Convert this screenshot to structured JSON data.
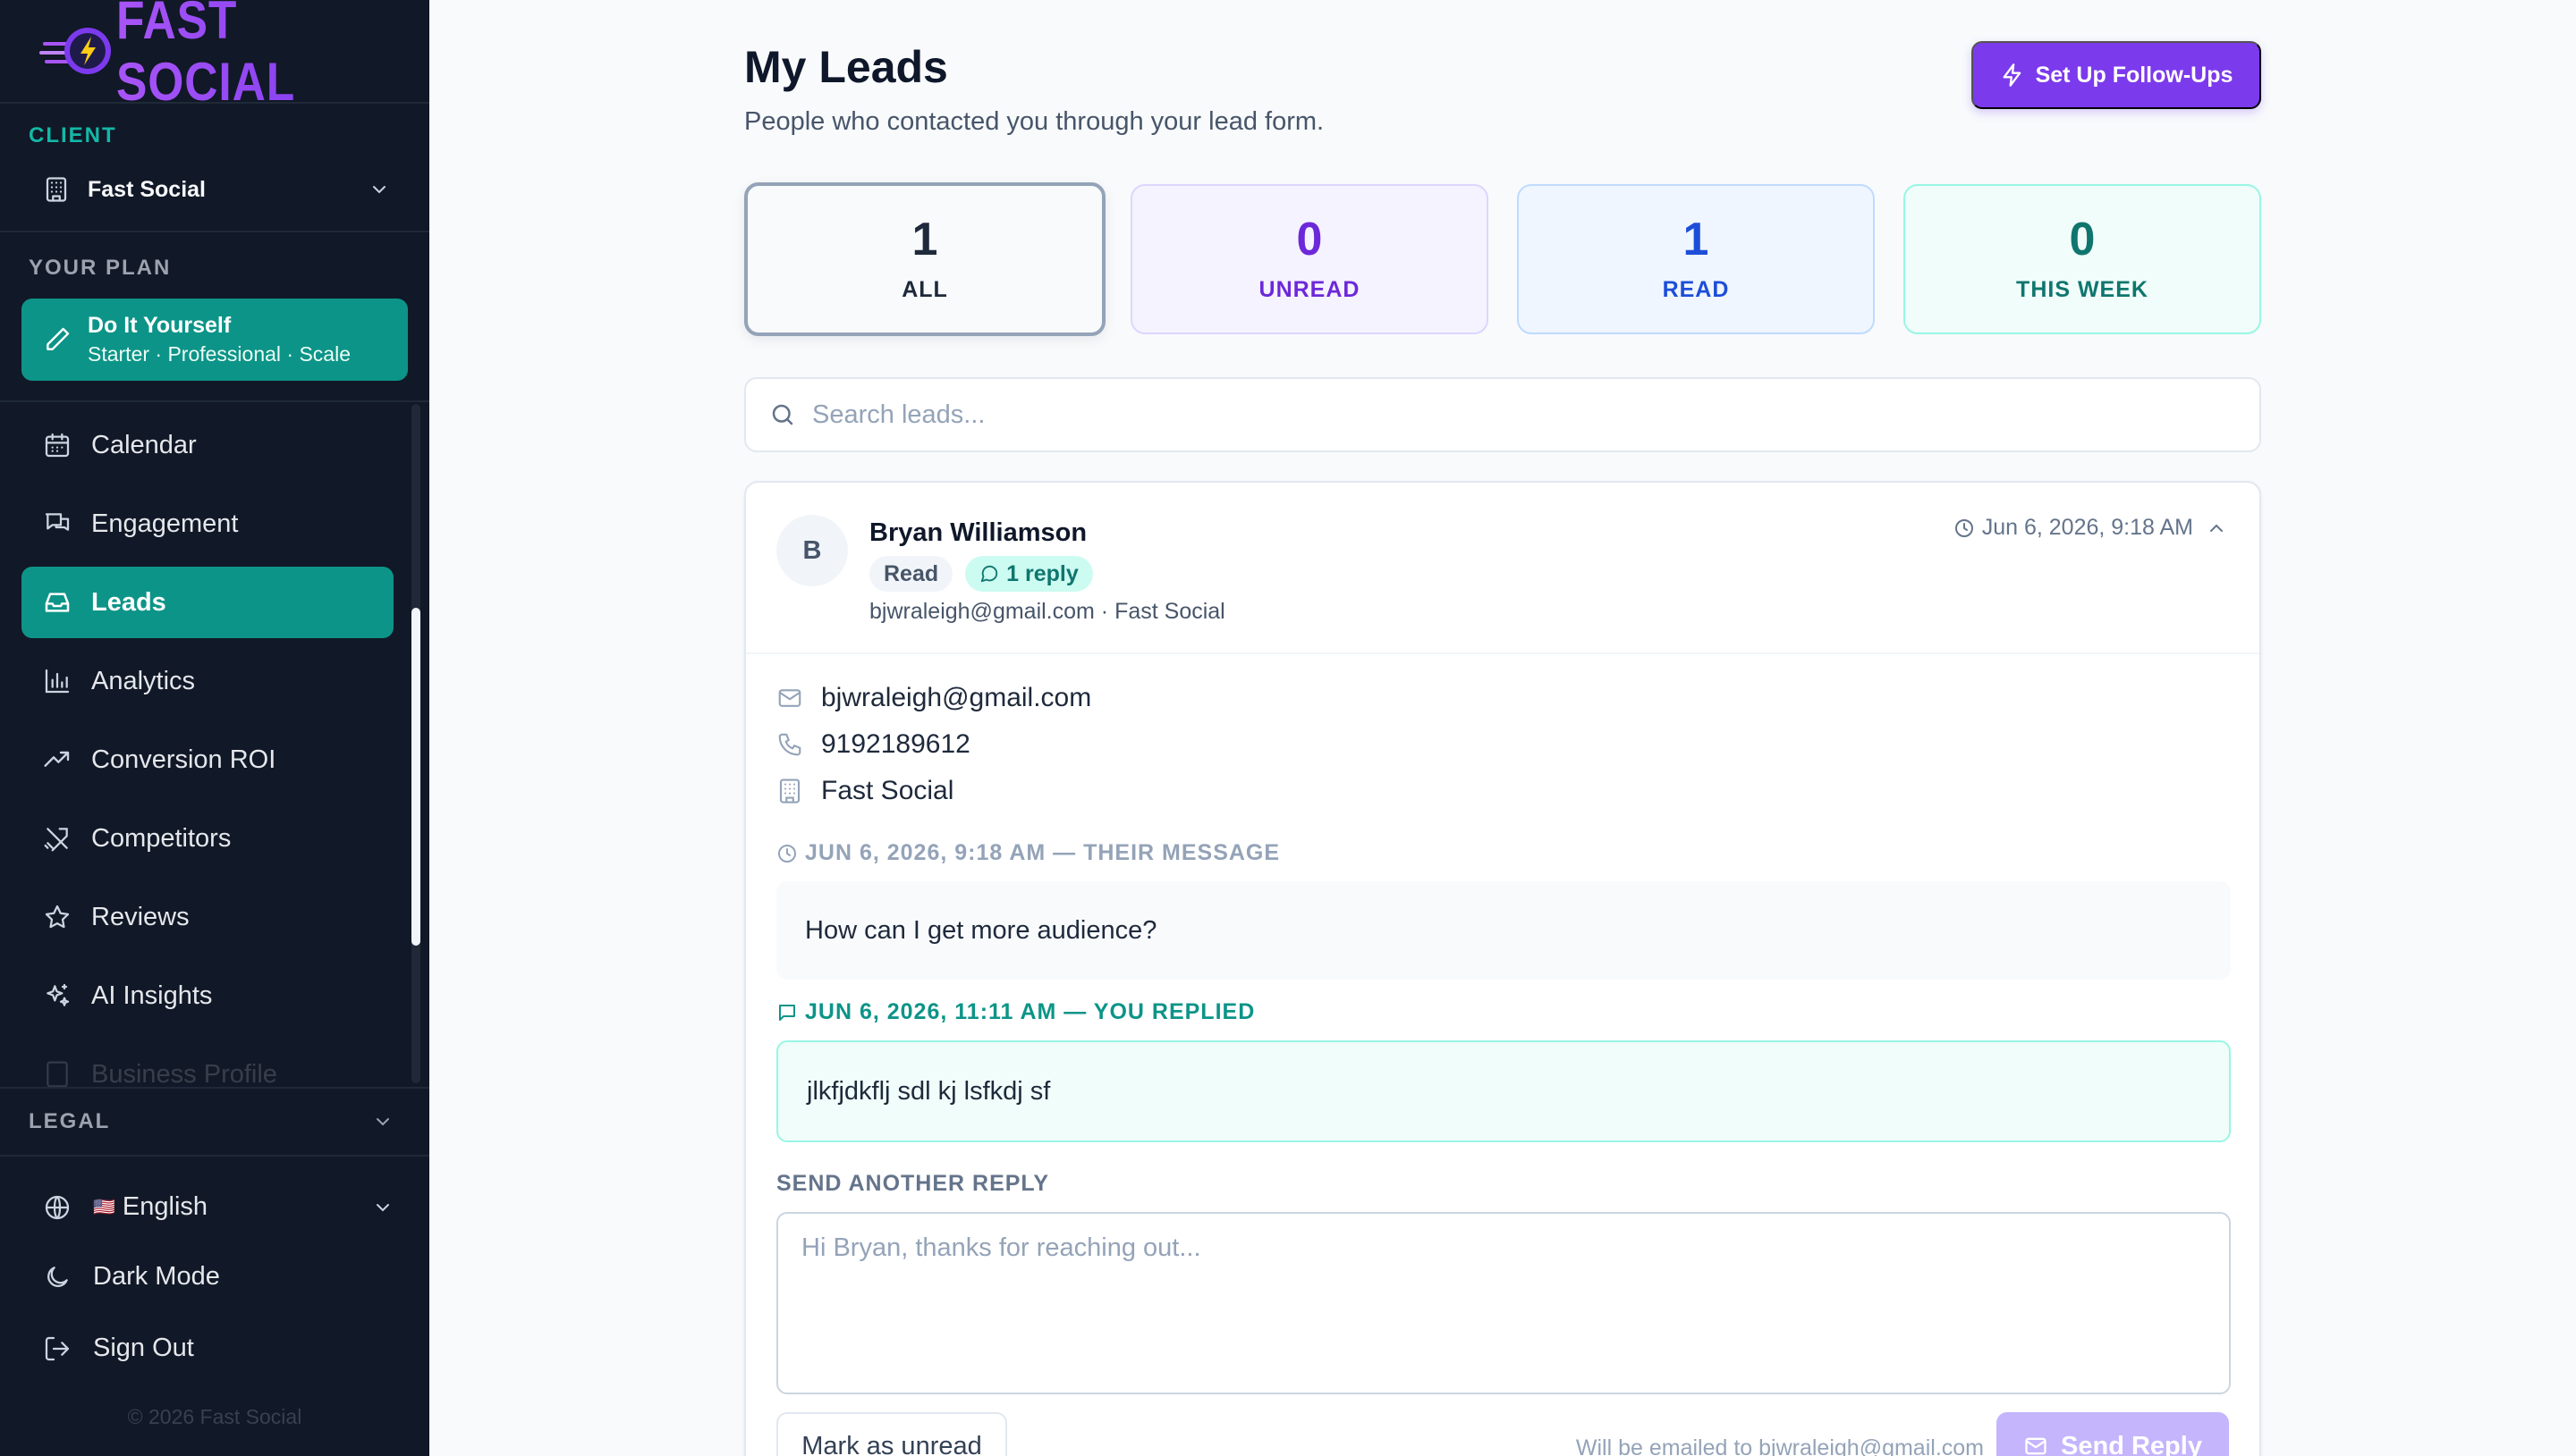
{
  "brand": {
    "name": "FAST SOCIAL"
  },
  "sidebar": {
    "client_label": "CLIENT",
    "client_value": "Fast Social",
    "plan_label": "YOUR PLAN",
    "plan_title": "Do It Yourself",
    "plan_tiers": "Starter · Professional · Scale",
    "items": [
      {
        "label": "Calendar",
        "icon": "calendar-icon"
      },
      {
        "label": "Engagement",
        "icon": "chat-icon"
      },
      {
        "label": "Leads",
        "icon": "inbox-icon",
        "active": true
      },
      {
        "label": "Analytics",
        "icon": "bar-chart-icon"
      },
      {
        "label": "Conversion ROI",
        "icon": "trending-up-icon"
      },
      {
        "label": "Competitors",
        "icon": "swords-icon"
      },
      {
        "label": "Reviews",
        "icon": "star-icon"
      },
      {
        "label": "AI Insights",
        "icon": "sparkles-icon"
      },
      {
        "label": "Business Profile",
        "icon": "building-icon"
      }
    ],
    "legal_label": "LEGAL",
    "language": "English",
    "language_flag": "🇺🇸",
    "dark_mode": "Dark Mode",
    "sign_out": "Sign Out",
    "copyright": "© 2026 Fast Social"
  },
  "header": {
    "title": "My Leads",
    "subtitle": "People who contacted you through your lead form.",
    "followup_button": "Set Up Follow-Ups"
  },
  "stats": [
    {
      "value": "1",
      "label": "ALL"
    },
    {
      "value": "0",
      "label": "UNREAD"
    },
    {
      "value": "1",
      "label": "READ"
    },
    {
      "value": "0",
      "label": "THIS WEEK"
    }
  ],
  "search": {
    "placeholder": "Search leads..."
  },
  "lead": {
    "initial": "B",
    "name": "Bryan Williamson",
    "status_badge": "Read",
    "reply_badge": "1 reply",
    "meta": "bjwraleigh@gmail.com · Fast Social",
    "date": "Jun 6, 2026, 9:18 AM",
    "email": "bjwraleigh@gmail.com",
    "phone": "9192189612",
    "company": "Fast Social",
    "their_caption": "JUN 6, 2026, 9:18 AM — THEIR MESSAGE",
    "their_message": "How can I get more audience?",
    "your_caption": "JUN 6, 2026, 11:11 AM — YOU REPLIED",
    "your_message": "jlkfjdkflj sdl kj lsfkdj sf",
    "send_caption": "SEND ANOTHER REPLY",
    "reply_placeholder": "Hi Bryan, thanks for reaching out...",
    "mark_unread": "Mark as unread",
    "emailed_to": "Will be emailed to bjwraleigh@gmail.com",
    "send_button": "Send Reply"
  },
  "colors": {
    "sidebar_bg": "#111827",
    "accent_teal": "#0d9488",
    "accent_purple": "#7c3aed"
  }
}
